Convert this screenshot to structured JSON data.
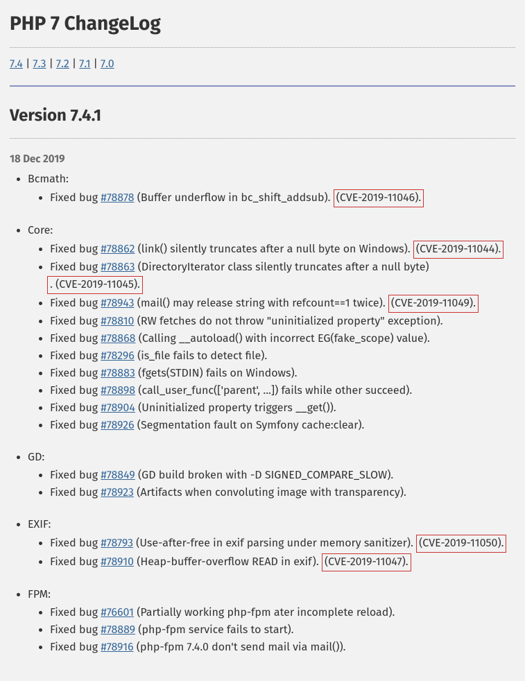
{
  "pageTitle": "PHP 7 ChangeLog",
  "versionNav": [
    "7.4",
    "7.3",
    "7.2",
    "7.1",
    "7.0"
  ],
  "versionHeading": "Version 7.4.1",
  "date": "18 Dec 2019",
  "bugPrefix": "Fixed bug",
  "sections": [
    {
      "name": "Bcmath",
      "bugs": [
        {
          "id": "#78878",
          "desc": "(Buffer underflow in bc_shift_addsub).",
          "cve": "(CVE-2019-11046)."
        }
      ]
    },
    {
      "name": "Core",
      "bugs": [
        {
          "id": "#78862",
          "desc": "(link() silently truncates after a null byte on Windows).",
          "cve": "(CVE-2019-11044)."
        },
        {
          "id": "#78863",
          "desc": "(DirectoryIterator class silently truncates after a null byte)",
          "cve": ". (CVE-2019-11045).",
          "cveTight": true
        },
        {
          "id": "#78943",
          "desc": "(mail() may release string with refcount==1 twice).",
          "cve": "(CVE-2019-11049)."
        },
        {
          "id": "#78810",
          "desc": "(RW fetches do not throw \"uninitialized property\" exception)."
        },
        {
          "id": "#78868",
          "desc": "(Calling __autoload() with incorrect EG(fake_scope) value)."
        },
        {
          "id": "#78296",
          "desc": "(is_file fails to detect file)."
        },
        {
          "id": "#78883",
          "desc": "(fgets(STDIN) fails on Windows)."
        },
        {
          "id": "#78898",
          "desc": "(call_user_func(['parent', ...]) fails while other succeed)."
        },
        {
          "id": "#78904",
          "desc": "(Uninitialized property triggers __get())."
        },
        {
          "id": "#78926",
          "desc": "(Segmentation fault on Symfony cache:clear)."
        }
      ]
    },
    {
      "name": "GD",
      "bugs": [
        {
          "id": "#78849",
          "desc": "(GD build broken with -D SIGNED_COMPARE_SLOW)."
        },
        {
          "id": "#78923",
          "desc": "(Artifacts when convoluting image with transparency)."
        }
      ]
    },
    {
      "name": "EXIF",
      "bugs": [
        {
          "id": "#78793",
          "desc": "(Use-after-free in exif parsing under memory sanitizer).",
          "cve": "(CVE-2019-11050)."
        },
        {
          "id": "#78910",
          "desc": "(Heap-buffer-overflow READ in exif).",
          "cve": "(CVE-2019-11047)."
        }
      ]
    },
    {
      "name": "FPM",
      "bugs": [
        {
          "id": "#76601",
          "desc": "(Partially working php-fpm ater incomplete reload)."
        },
        {
          "id": "#78889",
          "desc": "(php-fpm service fails to start)."
        },
        {
          "id": "#78916",
          "desc": "(php-fpm 7.4.0 don't send mail via mail())."
        }
      ]
    }
  ]
}
